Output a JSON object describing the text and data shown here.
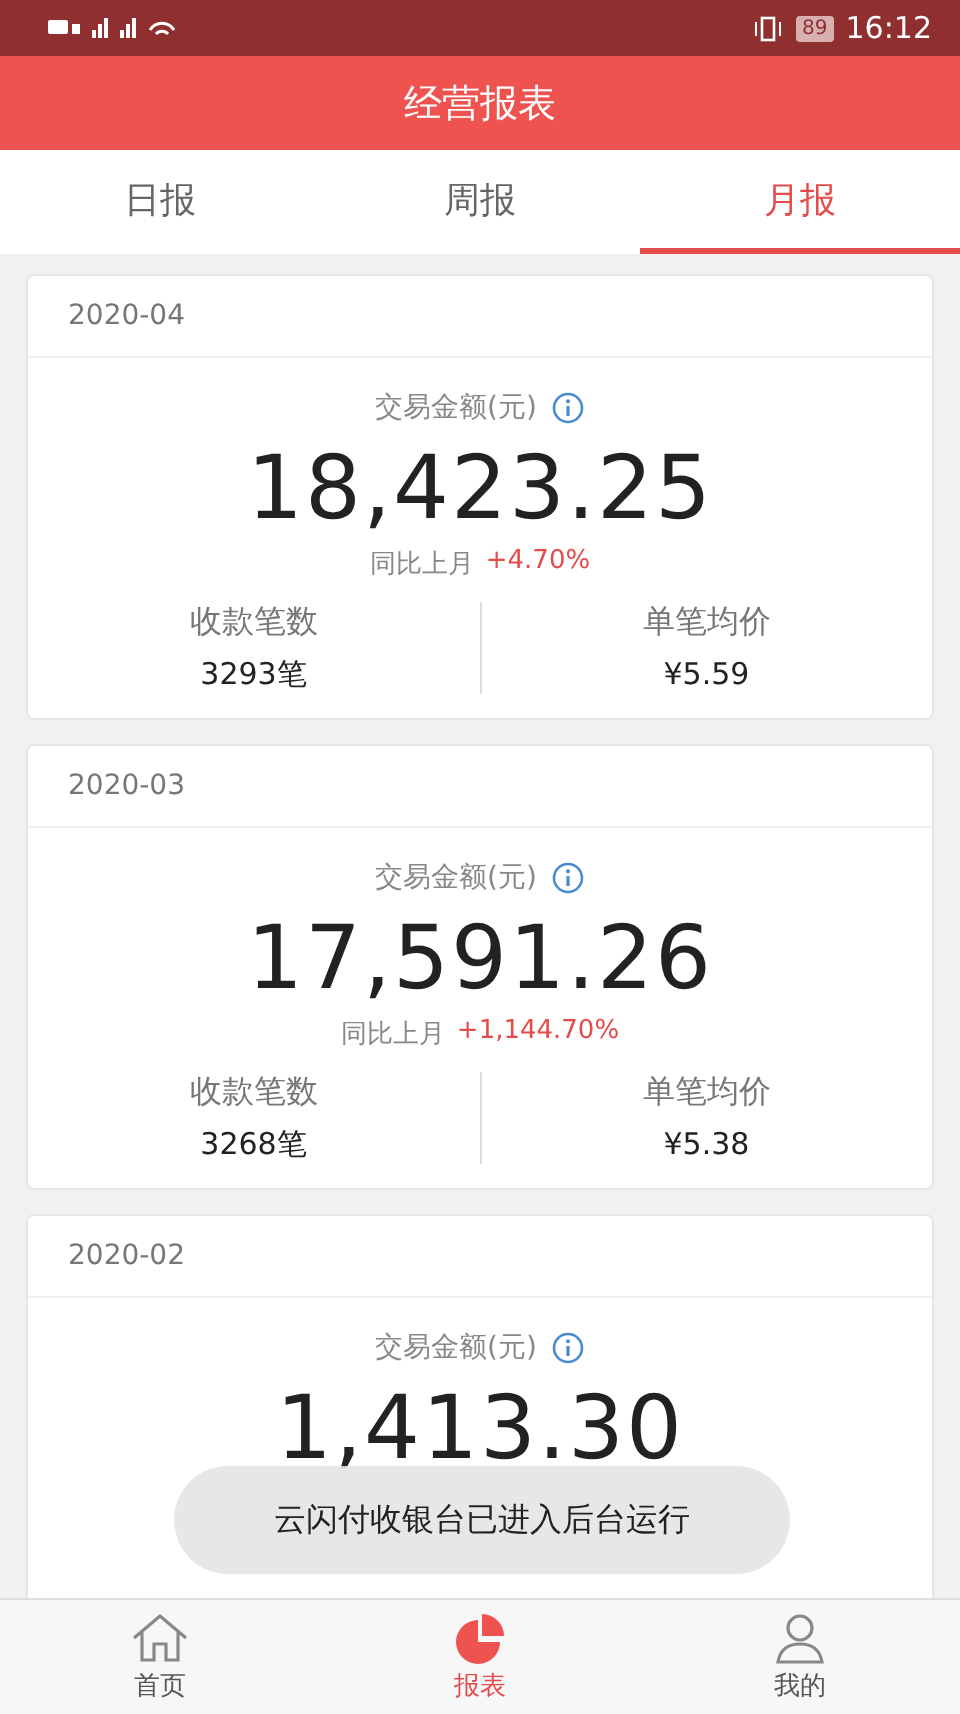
{
  "status_bar": {
    "battery": "89",
    "time": "16:12"
  },
  "header": {
    "title": "经营报表"
  },
  "tabs": [
    {
      "label": "日报",
      "selected": false
    },
    {
      "label": "周报",
      "selected": false
    },
    {
      "label": "月报",
      "selected": true
    }
  ],
  "cards": [
    {
      "date": "2020-04",
      "amount_label": "交易金额(元)",
      "amount": "18,423.25",
      "change_label": "同比上月",
      "change": "+4.70%",
      "stats": [
        {
          "label": "收款笔数",
          "value": "3293笔"
        },
        {
          "label": "单笔均价",
          "value": "¥5.59"
        }
      ]
    },
    {
      "date": "2020-03",
      "amount_label": "交易金额(元)",
      "amount": "17,591.26",
      "change_label": "同比上月",
      "change": "+1,144.70%",
      "stats": [
        {
          "label": "收款笔数",
          "value": "3268笔"
        },
        {
          "label": "单笔均价",
          "value": "¥5.38"
        }
      ]
    },
    {
      "date": "2020-02",
      "amount_label": "交易金额(元)",
      "amount": "1,413.30"
    }
  ],
  "toast": "云闪付收银台已进入后台运行",
  "bottom_nav": [
    {
      "label": "首页",
      "kind": "home",
      "selected": false
    },
    {
      "label": "报表",
      "kind": "chart",
      "selected": true
    },
    {
      "label": "我的",
      "kind": "user",
      "selected": false
    }
  ]
}
